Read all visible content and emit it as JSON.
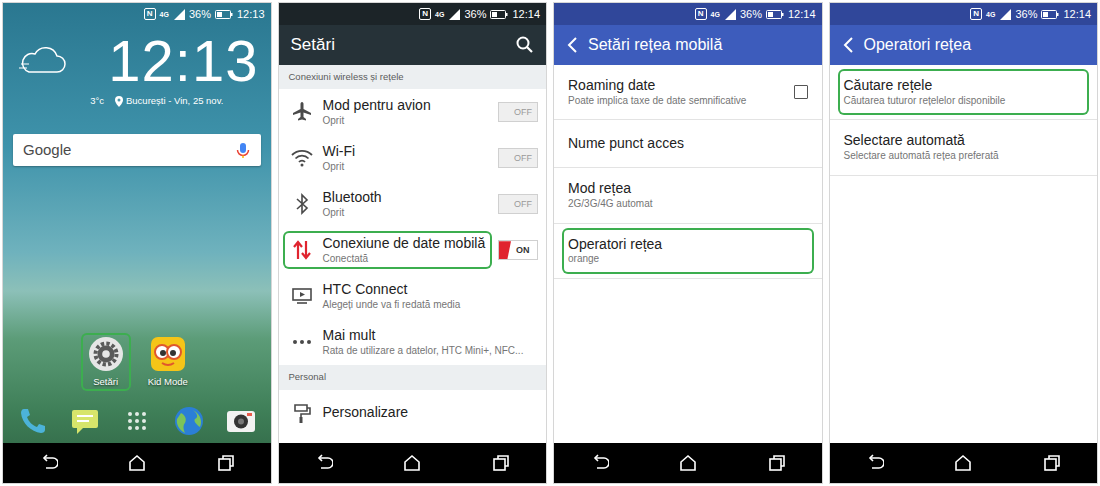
{
  "screens": [
    {
      "kind": "home",
      "status": {
        "nfc": "N",
        "network": "4G",
        "battery": "36%",
        "time": "12:13"
      },
      "clock": "12:13",
      "weather": {
        "temperature": "3°c",
        "place": "București - Vin, 25 nov."
      },
      "search": {
        "label": "Google"
      },
      "apps": [
        {
          "label": "Setări",
          "highlighted": true
        },
        {
          "label": "Kid Mode",
          "highlighted": false
        }
      ]
    },
    {
      "kind": "settings",
      "status": {
        "nfc": "N",
        "network": "4G",
        "battery": "36%",
        "time": "12:14"
      },
      "header": {
        "title": "Setări",
        "back": false,
        "search": true
      },
      "sections": [
        {
          "label": "Conexiuni wireless și rețele",
          "items": [
            {
              "kind": "toggle",
              "title": "Mod pentru avion",
              "subtitle": "Oprit",
              "switch": "OFF",
              "on": false,
              "highlighted": false
            },
            {
              "kind": "toggle",
              "title": "Wi-Fi",
              "subtitle": "Oprit",
              "switch": "OFF",
              "on": false,
              "highlighted": false
            },
            {
              "kind": "toggle",
              "title": "Bluetooth",
              "subtitle": "Oprit",
              "switch": "OFF",
              "on": false,
              "highlighted": false
            },
            {
              "kind": "toggle",
              "title": "Conexiune de date mobilă",
              "subtitle": "Conectată",
              "switch": "ON",
              "on": true,
              "highlighted": true
            },
            {
              "kind": "plain",
              "title": "HTC Connect",
              "subtitle": "Alegeți unde va fi redată media",
              "highlighted": false
            },
            {
              "kind": "plain",
              "title": "Mai mult",
              "subtitle": "Rata de utilizare a datelor, HTC Mini+, NFC...",
              "highlighted": false
            }
          ]
        },
        {
          "label": "Personal",
          "items": [
            {
              "kind": "plain",
              "title": "Personalizare",
              "highlighted": false
            }
          ]
        }
      ]
    },
    {
      "kind": "submenu",
      "status": {
        "nfc": "N",
        "network": "4G",
        "battery": "36%",
        "time": "12:14"
      },
      "header": {
        "title": "Setări rețea mobilă",
        "back": true,
        "search": false
      },
      "sections": [
        {
          "items": [
            {
              "kind": "checkbox",
              "title": "Roaming date",
              "subtitle": "Poate implica taxe de date semnificative",
              "checked": false,
              "highlighted": false
            },
            {
              "kind": "plain",
              "title": "Nume punct acces",
              "highlighted": false
            },
            {
              "kind": "plain",
              "title": "Mod rețea",
              "subtitle": "2G/3G/4G automat",
              "highlighted": false
            },
            {
              "kind": "plain",
              "title": "Operatori rețea",
              "subtitle": "orange",
              "highlighted": true
            }
          ]
        }
      ]
    },
    {
      "kind": "submenu",
      "status": {
        "nfc": "N",
        "network": "4G",
        "battery": "36%",
        "time": "12:14"
      },
      "header": {
        "title": "Operatori rețea",
        "back": true,
        "search": false
      },
      "sections": [
        {
          "items": [
            {
              "kind": "plain",
              "title": "Căutare rețele",
              "subtitle": "Căutarea tuturor rețelelor disponibile",
              "highlighted": true
            },
            {
              "kind": "plain",
              "title": "Selectare automată",
              "subtitle": "Selectare automată rețea preferată",
              "highlighted": false
            }
          ]
        }
      ]
    }
  ]
}
